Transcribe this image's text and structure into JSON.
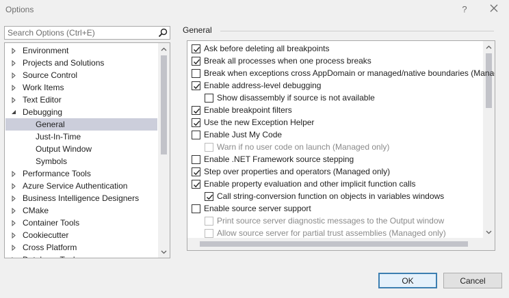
{
  "window": {
    "title": "Options",
    "help": "?"
  },
  "search": {
    "placeholder": "Search Options (Ctrl+E)"
  },
  "tree": {
    "items": [
      {
        "label": "Environment",
        "expander": "collapsed"
      },
      {
        "label": "Projects and Solutions",
        "expander": "collapsed"
      },
      {
        "label": "Source Control",
        "expander": "collapsed"
      },
      {
        "label": "Work Items",
        "expander": "collapsed"
      },
      {
        "label": "Text Editor",
        "expander": "collapsed"
      },
      {
        "label": "Debugging",
        "expander": "expanded"
      },
      {
        "label": "General",
        "expander": "none",
        "selected": true
      },
      {
        "label": "Just-In-Time",
        "expander": "none"
      },
      {
        "label": "Output Window",
        "expander": "none"
      },
      {
        "label": "Symbols",
        "expander": "none"
      },
      {
        "label": "Performance Tools",
        "expander": "collapsed"
      },
      {
        "label": "Azure Service Authentication",
        "expander": "collapsed"
      },
      {
        "label": "Business Intelligence Designers",
        "expander": "collapsed"
      },
      {
        "label": "CMake",
        "expander": "collapsed"
      },
      {
        "label": "Container Tools",
        "expander": "collapsed"
      },
      {
        "label": "Cookiecutter",
        "expander": "collapsed"
      },
      {
        "label": "Cross Platform",
        "expander": "collapsed"
      },
      {
        "label": "Database Tools",
        "expander": "collapsed"
      }
    ]
  },
  "section": {
    "title": "General"
  },
  "options": [
    {
      "label": "Ask before deleting all breakpoints",
      "checked": true,
      "enabled": true,
      "indent": 0
    },
    {
      "label": "Break all processes when one process breaks",
      "checked": true,
      "enabled": true,
      "indent": 0
    },
    {
      "label": "Break when exceptions cross AppDomain or managed/native boundaries (Managed only)",
      "checked": false,
      "enabled": true,
      "indent": 0
    },
    {
      "label": "Enable address-level debugging",
      "checked": true,
      "enabled": true,
      "indent": 0
    },
    {
      "label": "Show disassembly if source is not available",
      "checked": false,
      "enabled": true,
      "indent": 1
    },
    {
      "label": "Enable breakpoint filters",
      "checked": true,
      "enabled": true,
      "indent": 0
    },
    {
      "label": "Use the new Exception Helper",
      "checked": true,
      "enabled": true,
      "indent": 0
    },
    {
      "label": "Enable Just My Code",
      "checked": false,
      "enabled": true,
      "indent": 0
    },
    {
      "label": "Warn if no user code on launch (Managed only)",
      "checked": false,
      "enabled": false,
      "indent": 1
    },
    {
      "label": "Enable .NET Framework source stepping",
      "checked": false,
      "enabled": true,
      "indent": 0
    },
    {
      "label": "Step over properties and operators (Managed only)",
      "checked": true,
      "enabled": true,
      "indent": 0
    },
    {
      "label": "Enable property evaluation and other implicit function calls",
      "checked": true,
      "enabled": true,
      "indent": 0
    },
    {
      "label": "Call string-conversion function on objects in variables windows",
      "checked": true,
      "enabled": true,
      "indent": 1
    },
    {
      "label": "Enable source server support",
      "checked": false,
      "enabled": true,
      "indent": 0
    },
    {
      "label": "Print source server diagnostic messages to the Output window",
      "checked": false,
      "enabled": false,
      "indent": 1
    },
    {
      "label": "Allow source server for partial trust assemblies (Managed only)",
      "checked": false,
      "enabled": false,
      "indent": 1
    }
  ],
  "buttons": {
    "ok": "OK",
    "cancel": "Cancel"
  },
  "colors": {
    "selection": "#cccedb",
    "ok_border": "#3c7fb1",
    "window_bg": "#f0f0f0"
  },
  "icons": [
    "close-icon",
    "search-icon",
    "chevron-right-icon",
    "chevron-down-icon",
    "scroll-up-icon",
    "scroll-down-icon",
    "checkmark-icon"
  ]
}
